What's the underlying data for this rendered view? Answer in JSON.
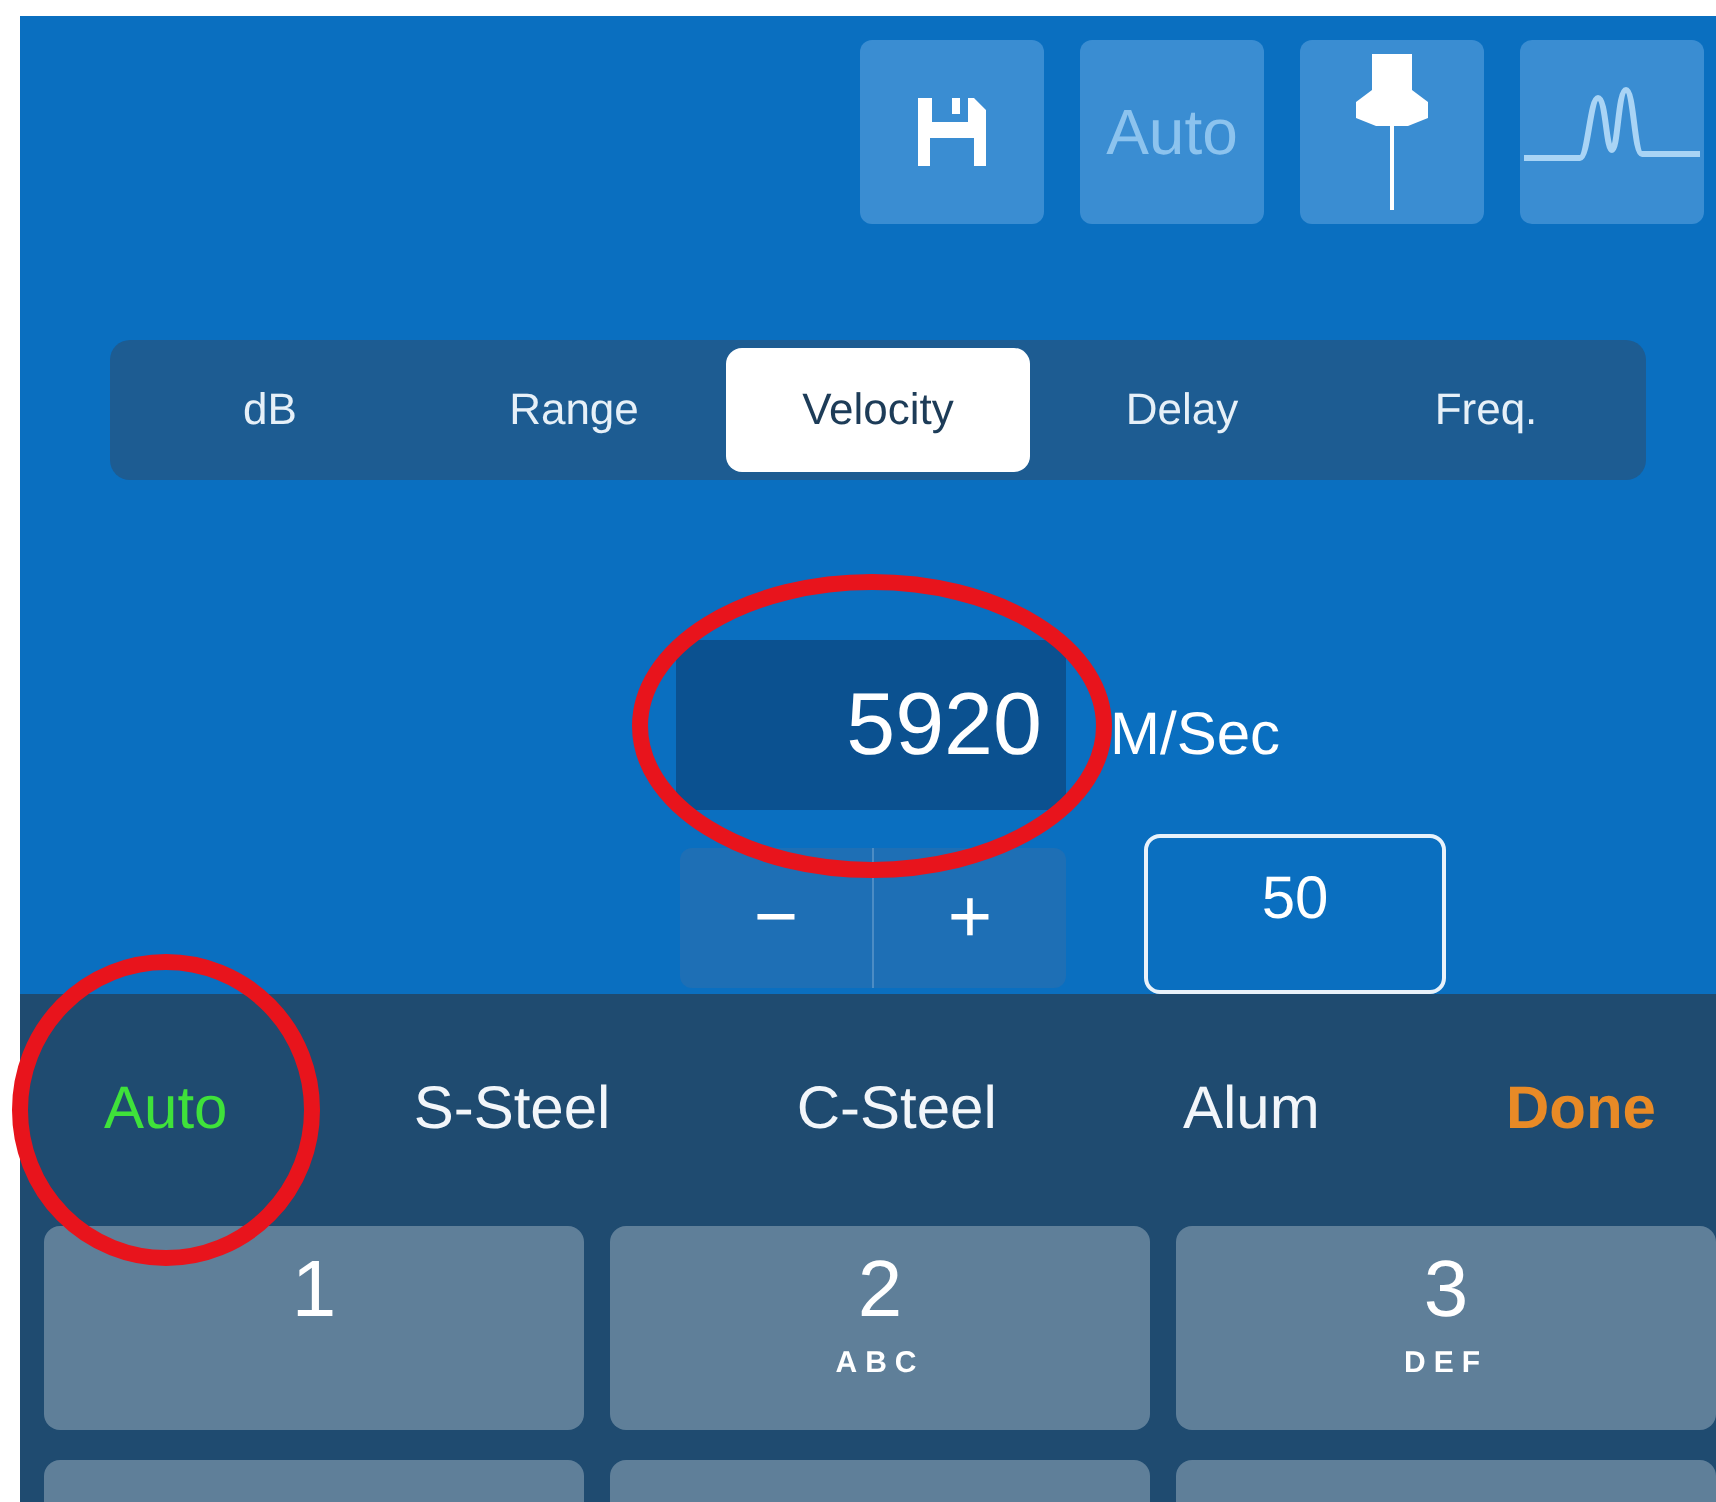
{
  "toolbar": [
    {
      "kind": "save"
    },
    {
      "kind": "text",
      "label": "Auto",
      "disabled": true
    },
    {
      "kind": "pin"
    },
    {
      "kind": "waveform"
    }
  ],
  "tabs": [
    {
      "label": "dB",
      "selected": false
    },
    {
      "label": "Range",
      "selected": false
    },
    {
      "label": "Velocity",
      "selected": true
    },
    {
      "label": "Delay",
      "selected": false
    },
    {
      "label": "Freq.",
      "selected": false
    }
  ],
  "value": {
    "text": "5920",
    "unit": "M/Sec",
    "circled": true
  },
  "stepper": {
    "minus": "−",
    "plus": "+",
    "step": "50"
  },
  "suggestions": [
    {
      "label": "Auto",
      "selected": true,
      "circled": true
    },
    {
      "label": "S-Steel",
      "selected": false,
      "circled": false
    },
    {
      "label": "C-Steel",
      "selected": false,
      "circled": false
    },
    {
      "label": "Alum",
      "selected": false,
      "circled": false
    }
  ],
  "done_button": "Done",
  "keys": [
    {
      "digit": "1"
    },
    {
      "digit": "2",
      "letters": "ABC"
    },
    {
      "digit": "3",
      "letters": "DEF"
    }
  ]
}
